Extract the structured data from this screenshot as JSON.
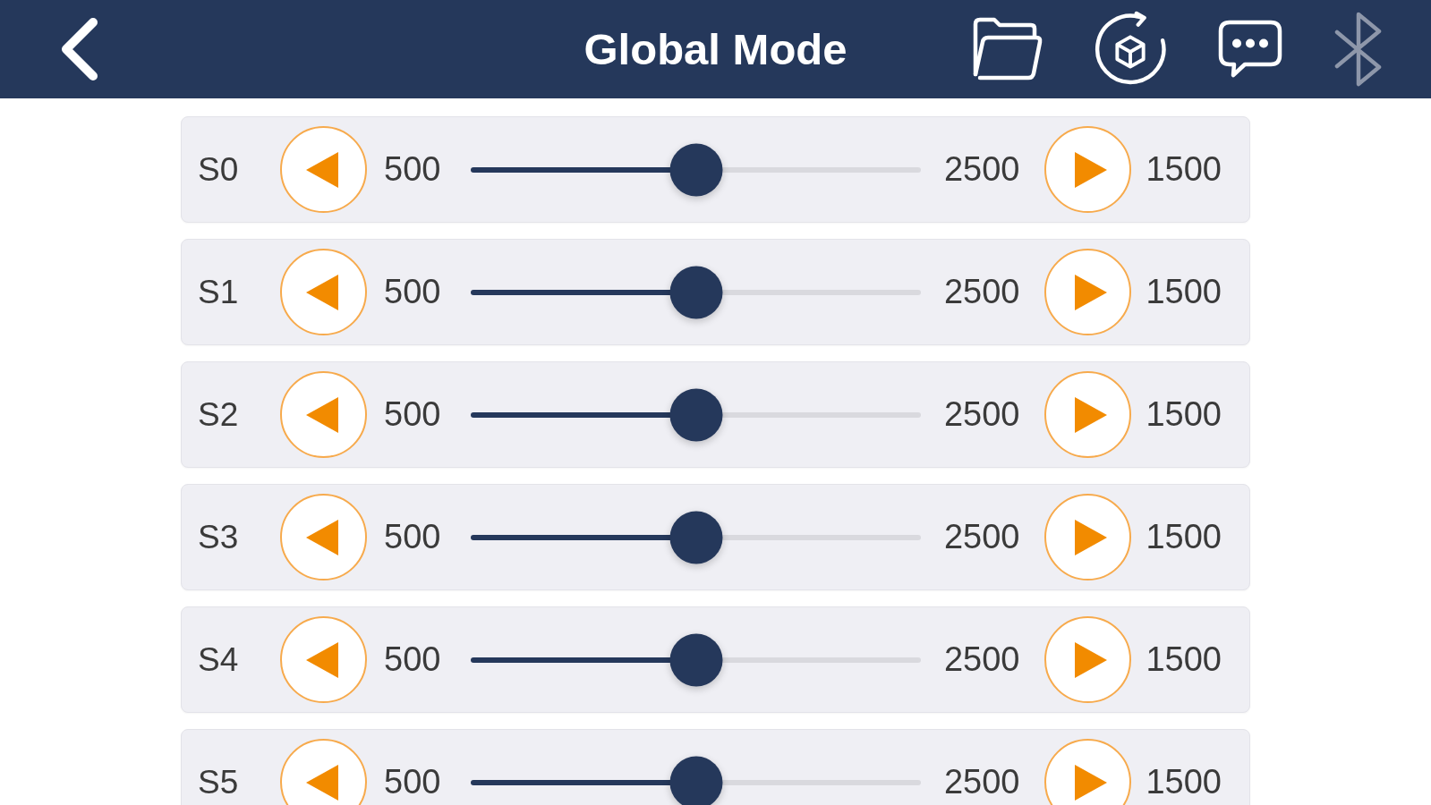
{
  "header": {
    "title": "Global Mode",
    "bluetooth_connected": false
  },
  "servos": [
    {
      "label": "S0",
      "min": "500",
      "max": "2500",
      "value": "1500",
      "level": 0.5
    },
    {
      "label": "S1",
      "min": "500",
      "max": "2500",
      "value": "1500",
      "level": 0.5
    },
    {
      "label": "S2",
      "min": "500",
      "max": "2500",
      "value": "1500",
      "level": 0.5
    },
    {
      "label": "S3",
      "min": "500",
      "max": "2500",
      "value": "1500",
      "level": 0.5
    },
    {
      "label": "S4",
      "min": "500",
      "max": "2500",
      "value": "1500",
      "level": 0.5
    },
    {
      "label": "S5",
      "min": "500",
      "max": "2500",
      "value": "1500",
      "level": 0.5
    }
  ]
}
